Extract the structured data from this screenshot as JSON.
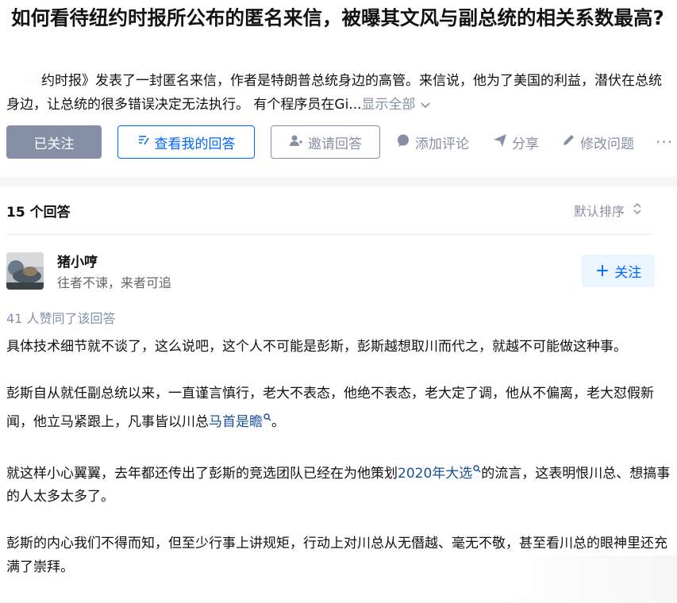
{
  "question": {
    "title": "如何看待纽约时报所公布的匿名来信，被曝其文风与副总统的相关系数最高?",
    "excerpt": "约时报》发表了一封匿名来信，作者是特朗普总统身边的高管。来信说，他为了美国的利益，潜伏在总统身边，让总统的很多错误决定无法执行。 有个程序员在Gi...",
    "show_all": "显示全部"
  },
  "actions": {
    "followed": "已关注",
    "my_answer": "查看我的回答",
    "invite": "邀请回答",
    "comment": "添加评论",
    "share": "分享",
    "edit": "修改问题",
    "more": "···"
  },
  "answers_header": {
    "count": "15 个回答",
    "sort": "默认排序"
  },
  "answer": {
    "author": "猪小哼",
    "bio": "往者不谏，来者可追",
    "follow": "关注",
    "votes": "41 人赞同了该回答",
    "p1": "具体技术细节就不谈了，这么说吧，这个人不可能是彭斯，彭斯越想取川而代之，就越不可能做这种事。",
    "p2_before": "彭斯自从就任副总统以来，一直谨言慎行，老大不表态，他绝不表态，老大定了调，他从不偏离，老大怼假新闻，他立马紧跟上，凡事皆以川总",
    "p2_link": "马首是瞻",
    "p2_after": "。",
    "p3_before": "就这样小心翼翼，去年都还传出了彭斯的竞选团队已经在为他策划",
    "p3_link": "2020年大选",
    "p3_after": "的流言，这表明恨川总、想搞事的人太多太多了。",
    "p4": "彭斯的内心我们不得而知，但至少行事上讲规矩，行动上对川总从无僭越、毫无不敬，甚至看川总的眼神里还充满了崇拜。"
  },
  "colors": {
    "primary_blue": "#0066ff",
    "gray_button": "#8590a6",
    "link_blue": "#175199",
    "follow_bg": "#ebf5ff"
  }
}
